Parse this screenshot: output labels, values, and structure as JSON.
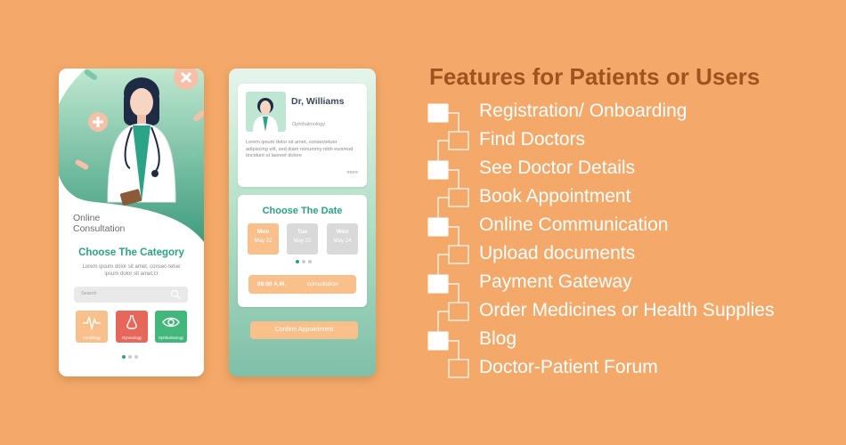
{
  "phone1": {
    "consult_label": "Online Consultation",
    "category_title": "Choose The Category",
    "category_desc": "Lorem ipsum dolor sit amet, consec-tetue ipsum dolor sit amet,cr",
    "search_placeholder": "Search",
    "categories": [
      {
        "label": "Cardiology",
        "icon": "heartbeat-icon",
        "color": "#f9c08c"
      },
      {
        "label": "Gynecology",
        "icon": "nose-icon",
        "color": "#e8675b"
      },
      {
        "label": "Ophthalmology",
        "icon": "eye-icon",
        "color": "#43b77b"
      }
    ]
  },
  "phone2": {
    "doctor_name": "Dr, Williams",
    "doctor_dept": "Ophthalmology",
    "doctor_desc": "Lorem ipsum dolor sit amet, consectetuer adipiscing elit, sed diam nonummy nibh euismod tincidunt ut laoreet dolore",
    "more": "more",
    "date_title": "Choose The Date",
    "dates": [
      {
        "day": "Mon",
        "date": "May 22",
        "selected": true
      },
      {
        "day": "Tue",
        "date": "May 23",
        "selected": false
      },
      {
        "day": "Wen",
        "date": "May 24",
        "selected": false
      }
    ],
    "time": "09:00 A.M.",
    "time_type": "consultation",
    "confirm": "Confirm Appointment"
  },
  "features": {
    "title": "Features for Patients or Users",
    "items": [
      "Registration/ Onboarding",
      "Find Doctors",
      "See Doctor Details",
      "Book Appointment",
      "Online Communication",
      "Upload documents",
      "Payment Gateway",
      "Order Medicines or Health Supplies",
      "Blog",
      "Doctor-Patient Forum"
    ]
  },
  "colors": {
    "background": "#F4A96A",
    "accent_green": "#2aa386",
    "title_brown": "#a0521f",
    "peach": "#f9c08c"
  }
}
